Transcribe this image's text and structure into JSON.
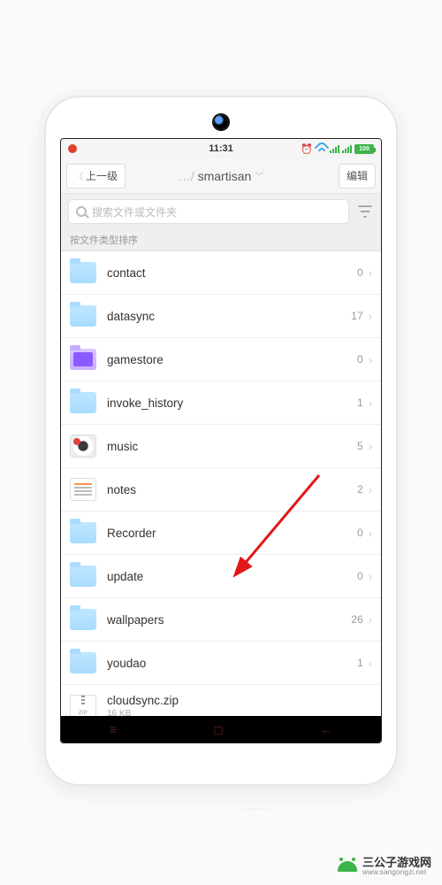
{
  "status": {
    "time": "11:31",
    "battery": "100"
  },
  "nav": {
    "back_label": "上一级",
    "title_prefix": "…/",
    "title": "smartisan",
    "edit_label": "编辑"
  },
  "search": {
    "placeholder": "搜索文件或文件夹"
  },
  "sort_label": "按文件类型排序",
  "items": [
    {
      "name": "contact",
      "count": "0",
      "icon": "folder"
    },
    {
      "name": "datasync",
      "count": "17",
      "icon": "folder"
    },
    {
      "name": "gamestore",
      "count": "0",
      "icon": "folder-purple"
    },
    {
      "name": "invoke_history",
      "count": "1",
      "icon": "folder"
    },
    {
      "name": "music",
      "count": "5",
      "icon": "music"
    },
    {
      "name": "notes",
      "count": "2",
      "icon": "notes"
    },
    {
      "name": "Recorder",
      "count": "0",
      "icon": "folder"
    },
    {
      "name": "update",
      "count": "0",
      "icon": "folder"
    },
    {
      "name": "wallpapers",
      "count": "26",
      "icon": "folder"
    },
    {
      "name": "youdao",
      "count": "1",
      "icon": "folder"
    },
    {
      "name": "cloudsync.zip",
      "sub": "16 KB",
      "icon": "zip",
      "ziplabel": "ZIP"
    }
  ],
  "watermark": {
    "cn": "三公子游戏网",
    "en": "www.sangongzi.net"
  }
}
